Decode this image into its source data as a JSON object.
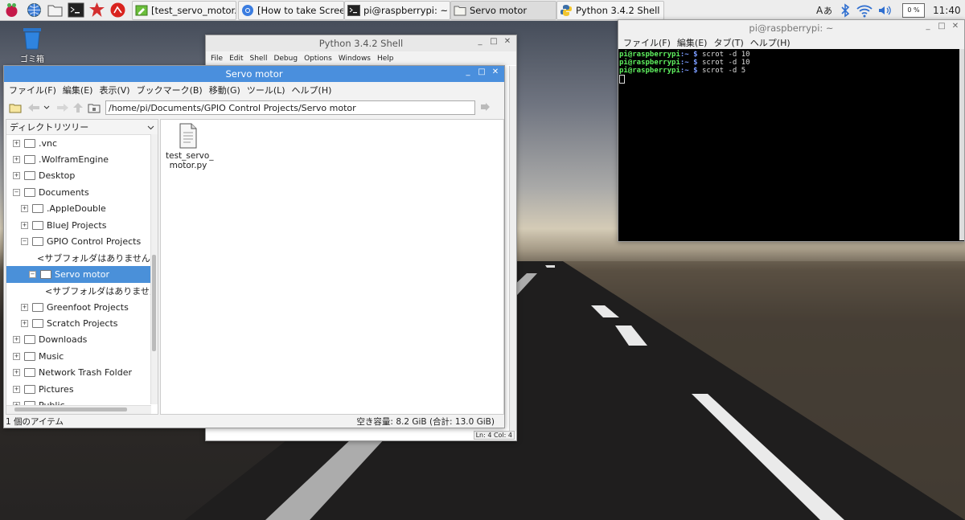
{
  "taskbar": {
    "windows": [
      {
        "label": "[test_servo_motor.py]",
        "icon": "python-editor-icon",
        "active": false
      },
      {
        "label": "[How to take Screens...",
        "icon": "chromium-icon",
        "active": false
      },
      {
        "label": "pi@raspberrypi: ~",
        "icon": "terminal-icon",
        "active": false
      },
      {
        "label": "Servo motor",
        "icon": "folder-icon",
        "active": true
      },
      {
        "label": "Python 3.4.2 Shell",
        "icon": "python-icon",
        "active": false
      }
    ],
    "cpu": "0 %",
    "clock": "11:40"
  },
  "desktop": {
    "trash_label": "ゴミ箱"
  },
  "python_shell": {
    "title": "Python 3.4.2 Shell",
    "menu": [
      "File",
      "Edit",
      "Shell",
      "Debug",
      "Options",
      "Windows",
      "Help"
    ],
    "status": "Ln: 4  Col: 4"
  },
  "file_manager": {
    "title": "Servo motor",
    "menu": [
      "ファイル(F)",
      "編集(E)",
      "表示(V)",
      "ブックマーク(B)",
      "移動(G)",
      "ツール(L)",
      "ヘルプ(H)"
    ],
    "path": "/home/pi/Documents/GPIO Control Projects/Servo motor",
    "tree_header": "ディレクトリツリー",
    "tree": [
      {
        "label": ".vnc",
        "indent": 0,
        "expander": "+",
        "selected": false
      },
      {
        "label": ".WolframEngine",
        "indent": 0,
        "expander": "+",
        "selected": false
      },
      {
        "label": "Desktop",
        "indent": 0,
        "expander": "+",
        "selected": false
      },
      {
        "label": "Documents",
        "indent": 0,
        "expander": "−",
        "selected": false
      },
      {
        "label": ".AppleDouble",
        "indent": 1,
        "expander": "+",
        "selected": false
      },
      {
        "label": "BlueJ Projects",
        "indent": 1,
        "expander": "+",
        "selected": false
      },
      {
        "label": "GPIO Control Projects",
        "indent": 1,
        "expander": "−",
        "selected": false
      },
      {
        "label": "<サブフォルダはありません>",
        "indent": 3,
        "expander": "",
        "selected": false
      },
      {
        "label": "Servo motor",
        "indent": 2,
        "expander": "−",
        "selected": true
      },
      {
        "label": "<サブフォルダはありません>",
        "indent": 4,
        "expander": "",
        "selected": false
      },
      {
        "label": "Greenfoot Projects",
        "indent": 1,
        "expander": "+",
        "selected": false
      },
      {
        "label": "Scratch Projects",
        "indent": 1,
        "expander": "+",
        "selected": false
      },
      {
        "label": "Downloads",
        "indent": 0,
        "expander": "+",
        "selected": false
      },
      {
        "label": "Music",
        "indent": 0,
        "expander": "+",
        "selected": false
      },
      {
        "label": "Network Trash Folder",
        "indent": 0,
        "expander": "+",
        "selected": false
      },
      {
        "label": "Pictures",
        "indent": 0,
        "expander": "+",
        "selected": false
      },
      {
        "label": "Public",
        "indent": 0,
        "expander": "+",
        "selected": false
      }
    ],
    "files": [
      {
        "name_line1": "test_servo_",
        "name_line2": "motor.py"
      }
    ],
    "status_left": "1 個のアイテム",
    "status_right": "空き容量: 8.2 GiB (合計: 13.0 GiB)"
  },
  "terminal": {
    "title": "pi@raspberrypi: ~",
    "menu": [
      "ファイル(F)",
      "編集(E)",
      "タブ(T)",
      "ヘルプ(H)"
    ],
    "lines": [
      {
        "prompt": "pi@raspberrypi",
        "dir": ":~ $",
        "cmd": " scrot -d 10"
      },
      {
        "prompt": "pi@raspberrypi",
        "dir": ":~ $",
        "cmd": " scrot -d 10"
      },
      {
        "prompt": "pi@raspberrypi",
        "dir": ":~ $",
        "cmd": " scrot -d 5"
      }
    ]
  }
}
